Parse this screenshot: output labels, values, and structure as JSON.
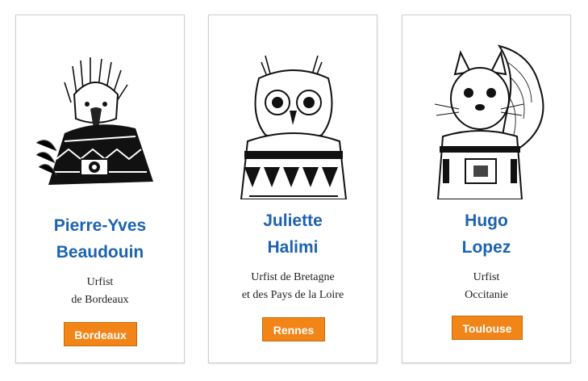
{
  "cards": [
    {
      "name_line1": "Pierre-Yves",
      "name_line2": "Beaudouin",
      "org_line1": "Urfist",
      "org_line2": "de Bordeaux",
      "button_label": "Bordeaux",
      "illustration": "eagle-illustration"
    },
    {
      "name_line1": "Juliette",
      "name_line2": "Halimi",
      "org_line1": "Urfist de Bretagne",
      "org_line2": "et des Pays de la Loire",
      "button_label": "Rennes",
      "illustration": "owl-illustration"
    },
    {
      "name_line1": "Hugo",
      "name_line2": "Lopez",
      "org_line1": "Urfist",
      "org_line2": "Occitanie",
      "button_label": "Toulouse",
      "illustration": "squirrel-illustration"
    }
  ],
  "colors": {
    "name_blue": "#1c63b0",
    "button_orange": "#f28518",
    "card_border": "#cfcfcf"
  }
}
